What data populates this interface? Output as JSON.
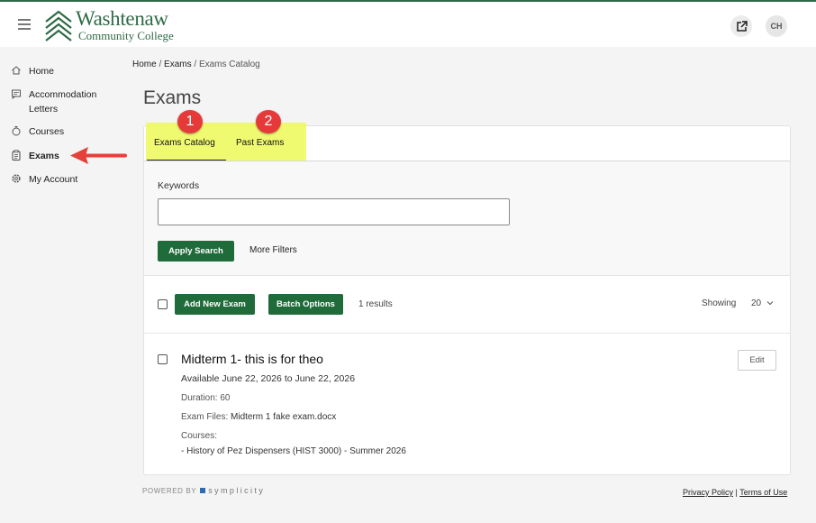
{
  "header": {
    "logo_line1": "Washtenaw",
    "logo_line2": "Community College",
    "avatar_initials": "CH",
    "icons": [
      "menu-icon",
      "external-link-icon"
    ]
  },
  "sidebar": {
    "items": [
      {
        "label": "Home",
        "icon": "home-icon"
      },
      {
        "label": "Accommodation Letters",
        "icon": "letters-icon"
      },
      {
        "label": "Courses",
        "icon": "courses-icon"
      },
      {
        "label": "Exams",
        "icon": "exams-icon",
        "active": true
      },
      {
        "label": "My Account",
        "icon": "gear-icon"
      }
    ]
  },
  "breadcrumb": {
    "home": "Home",
    "sep": "/",
    "exams": "Exams",
    "current": "Exams Catalog"
  },
  "page": {
    "title": "Exams"
  },
  "tabs": [
    {
      "label": "Exams Catalog",
      "active": true,
      "badge": "1"
    },
    {
      "label": "Past Exams",
      "active": false,
      "badge": "2"
    }
  ],
  "filters": {
    "keywords_label": "Keywords",
    "keywords_value": "",
    "apply_label": "Apply Search",
    "more_filters_label": "More Filters"
  },
  "toolbar": {
    "add_new_label": "Add New Exam",
    "batch_label": "Batch Options",
    "results_text": "1 results",
    "showing_label": "Showing",
    "page_size": "20"
  },
  "exam": {
    "title": "Midterm 1- this is for theo",
    "availability": "Available June 22, 2026 to June 22, 2026",
    "duration": "Duration: 60",
    "files_label": "Exam Files:",
    "files_value": "Midterm 1 fake exam.docx",
    "courses_label": "Courses:",
    "course_item": "- History of Pez Dispensers (HIST 3000) - Summer 2026",
    "edit_label": "Edit"
  },
  "footer": {
    "powered_by": "POWERED BY",
    "brand": "symplicity",
    "privacy": "Privacy Policy",
    "sep": "|",
    "terms": "Terms of Use"
  },
  "colors": {
    "brand_green": "#2f6b46",
    "button_green": "#1f6b3a",
    "highlight_yellow": "#eef95c",
    "badge_red": "#e63a3a",
    "arrow_red": "#e5413b"
  }
}
